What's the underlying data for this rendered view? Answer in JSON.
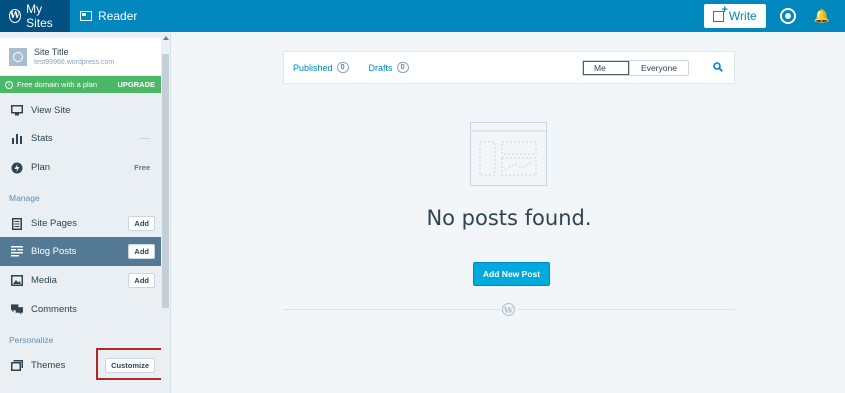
{
  "masterbar": {
    "my_sites_label": "My Sites",
    "reader_label": "Reader",
    "write_label": "Write",
    "logo_letter": "W"
  },
  "sidebar": {
    "site_title": "Site Title",
    "site_url": "test99966.wordpress.com",
    "upgrade_notice": "Free domain with a plan",
    "upgrade_link": "UPGRADE",
    "items": [
      {
        "label": "View Site",
        "icon": "monitor-icon"
      },
      {
        "label": "Stats",
        "icon": "bar-chart-icon"
      },
      {
        "label": "Plan",
        "icon": "plan-bolt-icon",
        "badge": "Free"
      }
    ],
    "manage_heading": "Manage",
    "manage_items": [
      {
        "label": "Site Pages",
        "icon": "pages-icon",
        "button": "Add"
      },
      {
        "label": "Blog Posts",
        "icon": "posts-icon",
        "button": "Add",
        "active": true
      },
      {
        "label": "Media",
        "icon": "image-icon",
        "button": "Add"
      },
      {
        "label": "Comments",
        "icon": "comments-icon"
      }
    ],
    "personalize_heading": "Personalize",
    "personalize_items": [
      {
        "label": "Themes",
        "icon": "themes-icon",
        "button": "Customize"
      }
    ]
  },
  "filter": {
    "tabs": [
      {
        "label": "Published",
        "count": "0"
      },
      {
        "label": "Drafts",
        "count": "0"
      }
    ],
    "author_options": [
      "Me",
      "Everyone"
    ],
    "author_selected": "Me"
  },
  "empty_state": {
    "title": "No posts found.",
    "action_label": "Add New Post"
  },
  "colors": {
    "masterbar": "#0087be",
    "active_nav": "#537994",
    "upgrade": "#4ab866",
    "primary_button": "#00aadc",
    "highlight": "#b52727"
  }
}
